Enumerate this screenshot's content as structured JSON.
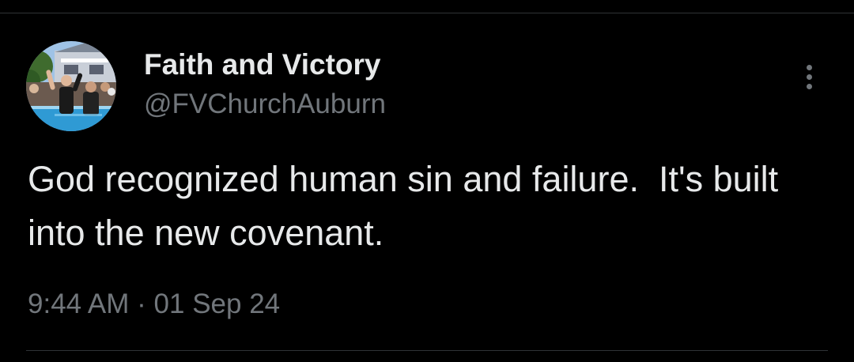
{
  "tweet": {
    "author": {
      "display_name": "Faith and Victory",
      "handle": "@FVChurchAuburn",
      "avatar_icon": "profile-photo-baptism"
    },
    "text": "God recognized human sin and failure.  It's built into the new covenant.",
    "time": "9:44 AM",
    "separator": "·",
    "date": "01 Sep 24",
    "more_icon": "more-vertical-icon"
  },
  "colors": {
    "background": "#000000",
    "primary_text": "#e7e9ea",
    "secondary_text": "#71767b",
    "divider": "#2f3336"
  }
}
